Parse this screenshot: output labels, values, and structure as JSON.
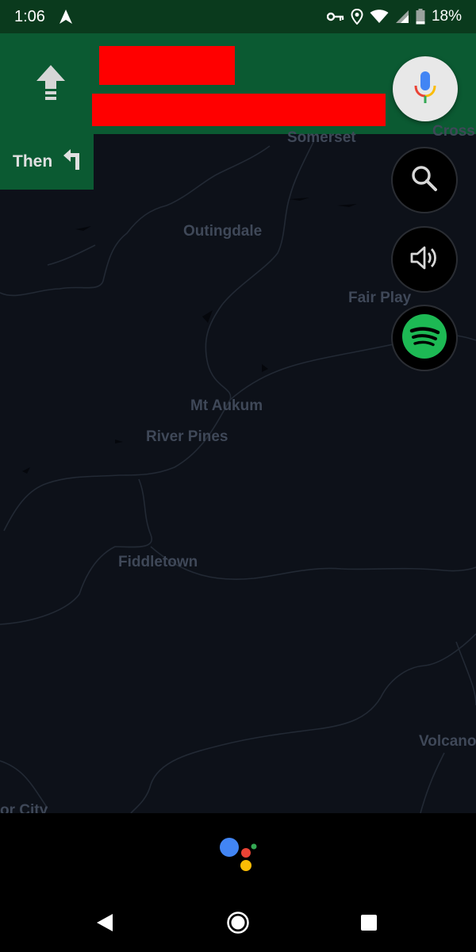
{
  "status_bar": {
    "time": "1:06",
    "battery": "18%",
    "icons": [
      "navigation-arrow-icon",
      "vpn-key-icon",
      "location-pin-icon",
      "wifi-icon",
      "cell-signal-icon",
      "battery-icon"
    ]
  },
  "nav_header": {
    "direction_icon": "straight-arrow-icon",
    "mic_icon": "google-mic-icon",
    "background_color": "#0b5a32"
  },
  "then_chip": {
    "label": "Then",
    "icon": "turn-left-icon"
  },
  "map": {
    "labels": [
      {
        "name": "somerset",
        "text": "Somerset"
      },
      {
        "name": "cross",
        "text": "Cross"
      },
      {
        "name": "outingdale",
        "text": "Outingdale"
      },
      {
        "name": "fair-play",
        "text": "Fair Play"
      },
      {
        "name": "mt-aukum",
        "text": "Mt Aukum"
      },
      {
        "name": "river-pines",
        "text": "River Pines"
      },
      {
        "name": "fiddletown",
        "text": "Fiddletown"
      },
      {
        "name": "volcano",
        "text": "Volcano"
      },
      {
        "name": "or-city",
        "text": "or City"
      }
    ]
  },
  "fabs": {
    "search_icon": "search-icon",
    "volume_icon": "volume-icon",
    "spotify_icon": "spotify-icon",
    "spotify_color": "#1db954"
  },
  "system_nav": {
    "icons": [
      "back-icon",
      "home-icon",
      "recents-icon"
    ]
  },
  "assistant": {
    "colors": [
      "#4285f4",
      "#ea4335",
      "#fbbc05",
      "#34a853"
    ]
  }
}
